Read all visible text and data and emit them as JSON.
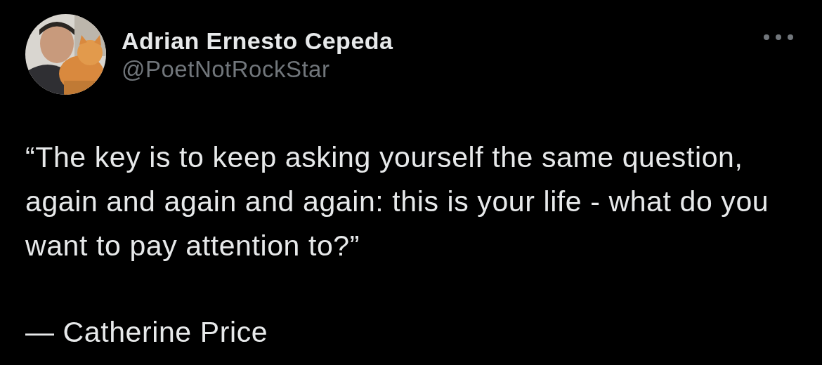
{
  "author": {
    "name": "Adrian Ernesto Cepeda",
    "handle": "@PoetNotRockStar"
  },
  "post": {
    "quote": "“The key is to keep asking yourself the same question, again and again and again: this is your life - what do you want to pay attention to?”",
    "attribution": "— Catherine Price"
  }
}
